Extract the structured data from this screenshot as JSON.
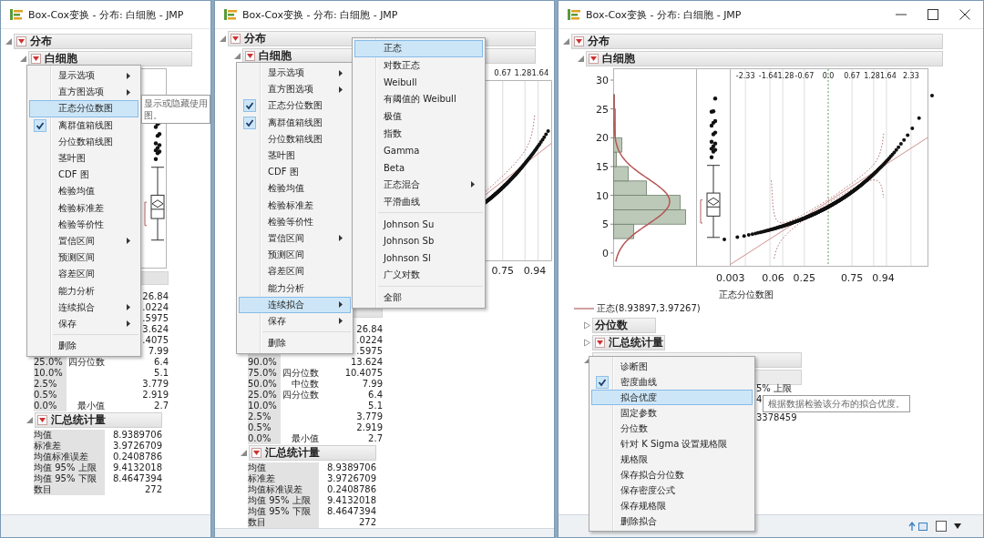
{
  "windows": [
    {
      "title": "Box-Cox变换 - 分布: 白细胞 - JMP",
      "window_buttons": false,
      "status_tools": false,
      "report": {
        "label": "分布",
        "expanded": true,
        "menu": true,
        "children": [
          {
            "label": "白细胞",
            "expanded": true,
            "menu": true,
            "blocks": [
              {
                "kind": "boxplot_plot"
              },
              {
                "kind": "quantiles",
                "rows": [
                  {
                    "value": "26.84"
                  },
                  {
                    "value": ".0224"
                  },
                  {
                    "value": ".5975"
                  },
                  {
                    "value": "3.624"
                  },
                  {
                    "value": ".4075"
                  },
                  {
                    "value": "7.99"
                  },
                  {
                    "pct": "25.0%",
                    "name": "四分位数",
                    "value": "6.4"
                  },
                  {
                    "pct": "10.0%",
                    "value": "5.1"
                  },
                  {
                    "pct": "2.5%",
                    "value": "3.779"
                  },
                  {
                    "pct": "0.5%",
                    "value": "2.919"
                  },
                  {
                    "pct": "0.0%",
                    "name": "最小值",
                    "value": "2.7"
                  }
                ]
              },
              {
                "kind": "summary",
                "label": "汇总统计量",
                "expanded": true,
                "menu": true,
                "rows": [
                  {
                    "name": "均值",
                    "value": "8.9389706"
                  },
                  {
                    "name": "标准差",
                    "value": "3.9726709"
                  },
                  {
                    "name": "均值标准误差",
                    "value": "0.2408786"
                  },
                  {
                    "name": "均值 95% 上限",
                    "value": "9.4132018"
                  },
                  {
                    "name": "均值 95% 下限",
                    "value": "8.4647394"
                  },
                  {
                    "name": "数目",
                    "value": "272"
                  }
                ]
              }
            ]
          }
        ]
      },
      "menus": [
        {
          "items": [
            {
              "kind": "item",
              "label": "显示选项",
              "submenu": true,
              "selected": false,
              "checked": false
            },
            {
              "kind": "item",
              "label": "直方图选项",
              "submenu": true,
              "selected": false,
              "checked": false
            },
            {
              "kind": "item",
              "label": "正态分位数图",
              "selected": true,
              "checked": false
            },
            {
              "kind": "item",
              "label": "离群值箱线图",
              "selected": false,
              "checked": true
            },
            {
              "kind": "item",
              "label": "分位数箱线图",
              "selected": false,
              "checked": false
            },
            {
              "kind": "item",
              "label": "茎叶图",
              "selected": false,
              "checked": false
            },
            {
              "kind": "item",
              "label": "CDF 图",
              "selected": false,
              "checked": false
            },
            {
              "kind": "item",
              "label": "检验均值",
              "selected": false,
              "checked": false
            },
            {
              "kind": "item",
              "label": "检验标准差",
              "selected": false,
              "checked": false
            },
            {
              "kind": "item",
              "label": "检验等价性",
              "selected": false,
              "checked": false
            },
            {
              "kind": "item",
              "label": "置信区间",
              "submenu": true,
              "selected": false,
              "checked": false
            },
            {
              "kind": "item",
              "label": "预测区间",
              "selected": false,
              "checked": false
            },
            {
              "kind": "item",
              "label": "容差区间",
              "selected": false,
              "checked": false
            },
            {
              "kind": "item",
              "label": "能力分析",
              "selected": false,
              "checked": false
            },
            {
              "kind": "item",
              "label": "连续拟合",
              "submenu": true,
              "selected": false,
              "checked": false
            },
            {
              "kind": "item",
              "label": "保存",
              "submenu": true,
              "selected": false,
              "checked": false
            },
            {
              "kind": "separator"
            },
            {
              "kind": "item",
              "label": "删除",
              "selected": false,
              "checked": false
            }
          ]
        }
      ],
      "tooltip": "显示或隐藏使用图。"
    },
    {
      "title": "Box-Cox变换 - 分布: 白细胞 - JMP",
      "window_buttons": false,
      "status_tools": false,
      "report": {
        "label": "分布",
        "expanded": true,
        "menu": true,
        "children": [
          {
            "label": "白细胞",
            "expanded": true,
            "menu": true,
            "blocks": [
              {
                "kind": "edge_plot",
                "top_ticks": [
                  "0.67",
                  "1.281.64"
                ],
                "bottom_ticks": [
                  "0.75",
                  "0.94"
                ]
              },
              {
                "kind": "quantiles",
                "rows": [
                  {
                    "value": "26.84"
                  },
                  {
                    "value": ".0224"
                  },
                  {
                    "value": ".5975"
                  },
                  {
                    "pct": "90.0%",
                    "value": "13.624"
                  },
                  {
                    "pct": "75.0%",
                    "name": "四分位数",
                    "value": "10.4075"
                  },
                  {
                    "pct": "50.0%",
                    "name": "中位数",
                    "value": "7.99"
                  },
                  {
                    "pct": "25.0%",
                    "name": "四分位数",
                    "value": "6.4"
                  },
                  {
                    "pct": "10.0%",
                    "value": "5.1"
                  },
                  {
                    "pct": "2.5%",
                    "value": "3.779"
                  },
                  {
                    "pct": "0.5%",
                    "value": "2.919"
                  },
                  {
                    "pct": "0.0%",
                    "name": "最小值",
                    "value": "2.7"
                  }
                ]
              },
              {
                "kind": "summary",
                "label": "汇总统计量",
                "expanded": true,
                "menu": true,
                "rows": [
                  {
                    "name": "均值",
                    "value": "8.9389706"
                  },
                  {
                    "name": "标准差",
                    "value": "3.9726709"
                  },
                  {
                    "name": "均值标准误差",
                    "value": "0.2408786"
                  },
                  {
                    "name": "均值 95% 上限",
                    "value": "9.4132018"
                  },
                  {
                    "name": "均值 95% 下限",
                    "value": "8.4647394"
                  },
                  {
                    "name": "数目",
                    "value": "272"
                  }
                ]
              }
            ]
          }
        ]
      },
      "menus": [
        {
          "items": [
            {
              "kind": "item",
              "label": "显示选项",
              "submenu": true,
              "selected": false,
              "checked": false
            },
            {
              "kind": "item",
              "label": "直方图选项",
              "submenu": true,
              "selected": false,
              "checked": false
            },
            {
              "kind": "item",
              "label": "正态分位数图",
              "selected": false,
              "checked": true
            },
            {
              "kind": "item",
              "label": "离群值箱线图",
              "selected": false,
              "checked": true
            },
            {
              "kind": "item",
              "label": "分位数箱线图",
              "selected": false,
              "checked": false
            },
            {
              "kind": "item",
              "label": "茎叶图",
              "selected": false,
              "checked": false
            },
            {
              "kind": "item",
              "label": "CDF 图",
              "selected": false,
              "checked": false
            },
            {
              "kind": "item",
              "label": "检验均值",
              "selected": false,
              "checked": false
            },
            {
              "kind": "item",
              "label": "检验标准差",
              "selected": false,
              "checked": false
            },
            {
              "kind": "item",
              "label": "检验等价性",
              "selected": false,
              "checked": false
            },
            {
              "kind": "item",
              "label": "置信区间",
              "submenu": true,
              "selected": false,
              "checked": false
            },
            {
              "kind": "item",
              "label": "预测区间",
              "selected": false,
              "checked": false
            },
            {
              "kind": "item",
              "label": "容差区间",
              "selected": false,
              "checked": false
            },
            {
              "kind": "item",
              "label": "能力分析",
              "selected": false,
              "checked": false
            },
            {
              "kind": "item",
              "label": "连续拟合",
              "submenu": true,
              "selected": true,
              "checked": false
            },
            {
              "kind": "item",
              "label": "保存",
              "submenu": true,
              "selected": false,
              "checked": false
            },
            {
              "kind": "separator"
            },
            {
              "kind": "item",
              "label": "删除",
              "selected": false,
              "checked": false
            }
          ]
        },
        {
          "items": [
            {
              "kind": "item",
              "label": "正态",
              "selected": true
            },
            {
              "kind": "item",
              "label": "对数正态",
              "selected": false
            },
            {
              "kind": "item",
              "label": "Weibull",
              "selected": false
            },
            {
              "kind": "item",
              "label": "有阈值的 Weibull",
              "selected": false
            },
            {
              "kind": "item",
              "label": "极值",
              "selected": false
            },
            {
              "kind": "item",
              "label": "指数",
              "selected": false
            },
            {
              "kind": "item",
              "label": "Gamma",
              "selected": false
            },
            {
              "kind": "item",
              "label": "Beta",
              "selected": false
            },
            {
              "kind": "item",
              "label": "正态混合",
              "submenu": true,
              "selected": false
            },
            {
              "kind": "item",
              "label": "平滑曲线",
              "selected": false
            },
            {
              "kind": "separator"
            },
            {
              "kind": "item",
              "label": "Johnson Su",
              "selected": false
            },
            {
              "kind": "item",
              "label": "Johnson Sb",
              "selected": false
            },
            {
              "kind": "item",
              "label": "Johnson Sl",
              "selected": false
            },
            {
              "kind": "item",
              "label": "广义对数",
              "selected": false
            },
            {
              "kind": "separator"
            },
            {
              "kind": "item",
              "label": "全部",
              "selected": false
            }
          ]
        }
      ]
    },
    {
      "title": "Box-Cox变换 - 分布: 白细胞 - JMP",
      "window_buttons": true,
      "status_tools": true,
      "report": {
        "label": "分布",
        "expanded": true,
        "menu": true,
        "children": [
          {
            "label": "白细胞",
            "expanded": true,
            "menu": true,
            "blocks": [
              {
                "kind": "full_plot",
                "y_ticks": [
                  "30",
                  "25",
                  "20",
                  "15",
                  "10",
                  "5",
                  "0"
                ],
                "top_ticks": [
                  "-2.33",
                  "-1.641.28",
                  "-0.67",
                  "0.0",
                  "0.67",
                  "1.281.64",
                  "2.33"
                ],
                "bottom_ticks": [
                  "0.003",
                  "0.06",
                  "0.25",
                  "0.75",
                  "0.94"
                ],
                "xlabel": "正态分位数图"
              },
              {
                "kind": "legend",
                "text": "正态(8.93897,3.97267)"
              },
              {
                "kind": "section",
                "label": "分位数",
                "expanded": false,
                "menu": false
              },
              {
                "kind": "section",
                "label": "汇总统计量",
                "expanded": false,
                "menu": true
              },
              {
                "kind": "fit",
                "expanded": true,
                "fragments": [
                  "5% 上限",
                  "4",
                  "3378459"
                ]
              }
            ]
          }
        ]
      },
      "menus": [
        {
          "items": [
            {
              "kind": "item",
              "label": "诊断图",
              "selected": false,
              "checked": false
            },
            {
              "kind": "item",
              "label": "密度曲线",
              "selected": false,
              "checked": true
            },
            {
              "kind": "item",
              "label": "拟合优度",
              "selected": true,
              "checked": false
            },
            {
              "kind": "item",
              "label": "固定参数",
              "selected": false,
              "checked": false
            },
            {
              "kind": "item",
              "label": "分位数",
              "selected": false,
              "checked": false
            },
            {
              "kind": "item",
              "label": "针对 K Sigma 设置规格限",
              "selected": false,
              "checked": false
            },
            {
              "kind": "item",
              "label": "规格限",
              "selected": false,
              "checked": false
            },
            {
              "kind": "item",
              "label": "保存拟合分位数",
              "selected": false,
              "checked": false
            },
            {
              "kind": "item",
              "label": "保存密度公式",
              "selected": false,
              "checked": false
            },
            {
              "kind": "item",
              "label": "保存规格限",
              "selected": false,
              "checked": false
            },
            {
              "kind": "item",
              "label": "删除拟合",
              "selected": false,
              "checked": false
            }
          ]
        }
      ],
      "tooltip": "根据数据检验该分布的拟合优度。"
    }
  ]
}
